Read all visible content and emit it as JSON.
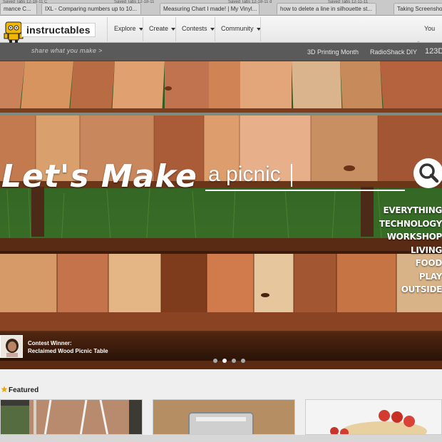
{
  "browser": {
    "tabs": [
      {
        "label": "mance C..."
      },
      {
        "label": "IXL - Comparing numbers up to 10..."
      },
      {
        "label": "Measuring Chart I made! | My Vinyl..."
      },
      {
        "label": "how to delete a line in silhouette st..."
      },
      {
        "label": "Taking Screensho"
      }
    ],
    "top_labels": [
      "Saved Tabs 12-18-11 C",
      "Saved Tabs 12-18-11",
      "Saved Tabs 12-18-11 d",
      "Saved Tabs 12-11-11"
    ]
  },
  "nav": {
    "logo_text": "instructables",
    "items": [
      {
        "label": "Explore"
      },
      {
        "label": "Create"
      },
      {
        "label": "Contests"
      },
      {
        "label": "Community"
      }
    ],
    "user_label": "You"
  },
  "subnav": {
    "tagline": "share what you make >",
    "links": [
      {
        "label": "3D Printing Month"
      },
      {
        "label": "RadioShack DIY"
      },
      {
        "label": "123D"
      }
    ]
  },
  "hero": {
    "headline": "Let's Make",
    "search_value": "a picnic",
    "categories": [
      "EVERYTHING",
      "TECHNOLOGY",
      "WORKSHOP",
      "LIVING",
      "FOOD",
      "PLAY",
      "OUTSIDE"
    ],
    "caption_line1": "Contest Winner:",
    "caption_line2": "Reclaimed Wood Picnic Table",
    "dots": [
      false,
      true,
      false,
      false
    ]
  },
  "featured": {
    "title": "Featured"
  },
  "colors": {
    "accent": "#f0a500",
    "subbar": "#5a5a5a",
    "wood_light": "#d58a57",
    "wood_dark": "#8f4a25"
  }
}
